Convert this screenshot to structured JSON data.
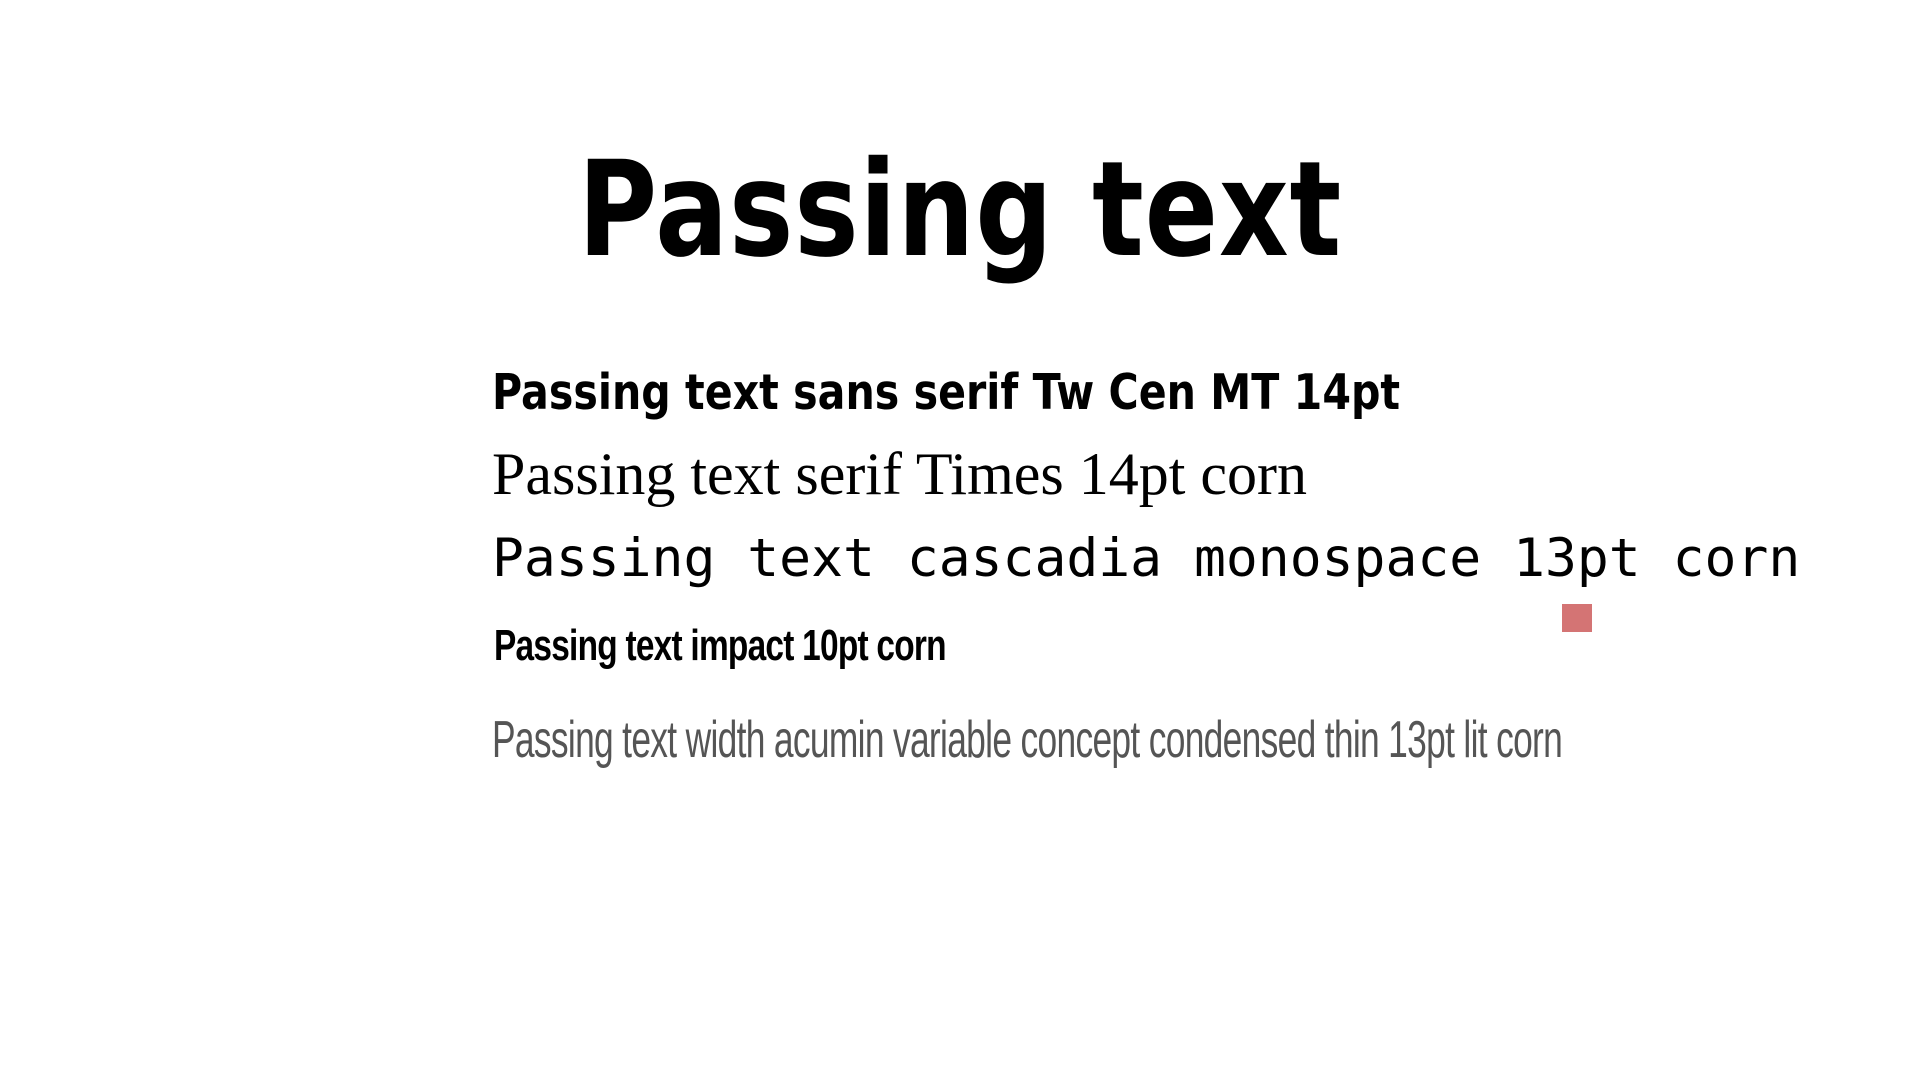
{
  "slide": {
    "title": "Passing text",
    "lines": {
      "sans": "Passing text sans serif Tw Cen MT 14pt",
      "serif": "Passing text serif Times 14pt corn",
      "mono": "Passing text cascadia monospace 13pt corn",
      "impact": "Passing text impact 10pt corn",
      "thin": "Passing text width acumin variable concept condensed thin 13pt lit corn"
    },
    "marker_color": "#d47474",
    "text_color": "#000000",
    "thin_text_color": "#555555"
  }
}
